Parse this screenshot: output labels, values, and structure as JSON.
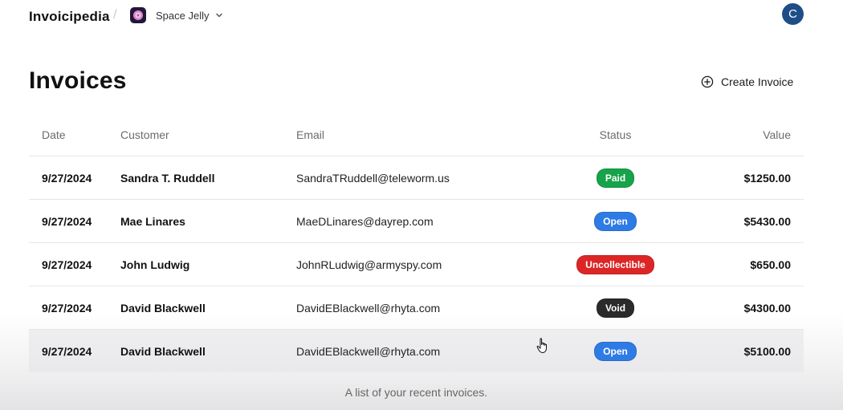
{
  "header": {
    "brand": "Invoicipedia",
    "separator": "/",
    "workspace_name": "Space Jelly",
    "avatar_initial": "C"
  },
  "page": {
    "title": "Invoices",
    "create_button_label": "Create Invoice"
  },
  "table": {
    "columns": {
      "date": "Date",
      "customer": "Customer",
      "email": "Email",
      "status": "Status",
      "value": "Value"
    },
    "rows": [
      {
        "date": "9/27/2024",
        "customer": "Sandra T. Ruddell",
        "email": "SandraTRuddell@teleworm.us",
        "status": "Paid",
        "status_color": "#16a34a",
        "value": "$1250.00"
      },
      {
        "date": "9/27/2024",
        "customer": "Mae Linares",
        "email": "MaeDLinares@dayrep.com",
        "status": "Open",
        "status_color": "#2f7be5",
        "value": "$5430.00"
      },
      {
        "date": "9/27/2024",
        "customer": "John Ludwig",
        "email": "JohnRLudwig@armyspy.com",
        "status": "Uncollectible",
        "status_color": "#dc2626",
        "value": "$650.00"
      },
      {
        "date": "9/27/2024",
        "customer": "David Blackwell",
        "email": "DavidEBlackwell@rhyta.com",
        "status": "Void",
        "status_color": "#2b2b2b",
        "value": "$4300.00"
      },
      {
        "date": "9/27/2024",
        "customer": "David Blackwell",
        "email": "DavidEBlackwell@rhyta.com",
        "status": "Open",
        "status_color": "#2f7be5",
        "value": "$5100.00"
      }
    ],
    "caption": "A list of your recent invoices."
  },
  "icons": {
    "workspace_logo": "jellyfish-icon",
    "dropdown": "chevron-down-icon",
    "create": "plus-circle-icon",
    "cursor": "hand-pointer-icon"
  },
  "colors": {
    "avatar": "#1f4e87",
    "workspace_logo_bg": "#24163a"
  }
}
